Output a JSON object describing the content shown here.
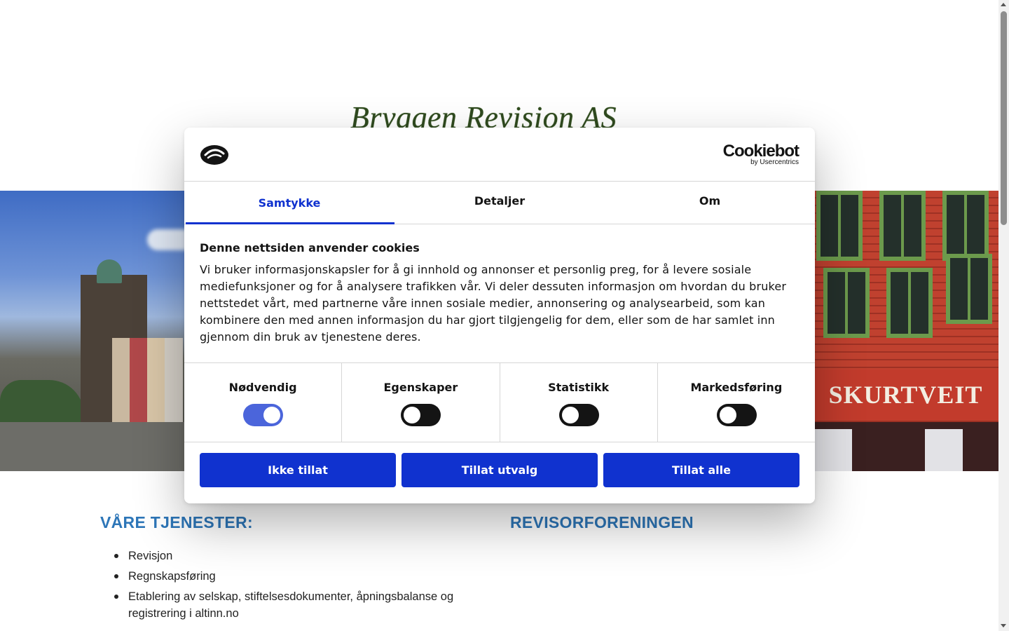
{
  "site": {
    "title": "Bryggen Revision AS",
    "hero_sign": "SKURTVEIT"
  },
  "sections": {
    "services_heading": "VÅRE TJENESTER:",
    "services": [
      "Revisjon",
      "Regnskapsføring",
      "Etablering av selskap, stiftelsesdokumenter, åpningsbalanse og registrering i altinn.no"
    ],
    "revisor_heading": "REVISORFORENINGEN"
  },
  "cookie": {
    "brand": {
      "name": "Cookiebot",
      "sub": "by Usercentrics"
    },
    "tabs": [
      "Samtykke",
      "Detaljer",
      "Om"
    ],
    "active_tab": "Samtykke",
    "body_title": "Denne nettsiden anvender cookies",
    "body_text": "Vi bruker informasjonskapsler for å gi innhold og annonser et personlig preg, for å levere sosiale mediefunksjoner og for å analysere trafikken vår. Vi deler dessuten informasjon om hvordan du bruker nettstedet vårt, med partnerne våre innen sosiale medier, annonsering og analysearbeid, som kan kombinere den med annen informasjon du har gjort tilgjengelig for dem, eller som de har samlet inn gjennom din bruk av tjenestene deres.",
    "categories": [
      {
        "label": "Nødvendig",
        "enabled": true
      },
      {
        "label": "Egenskaper",
        "enabled": false
      },
      {
        "label": "Statistikk",
        "enabled": false
      },
      {
        "label": "Markedsføring",
        "enabled": false
      }
    ],
    "buttons": {
      "deny": "Ikke tillat",
      "selection": "Tillat utvalg",
      "allow_all": "Tillat alle"
    },
    "accent_color": "#1032cf"
  },
  "colors": {
    "heading_blue": "#2d76b8",
    "title_green": "#2f4a1f"
  }
}
